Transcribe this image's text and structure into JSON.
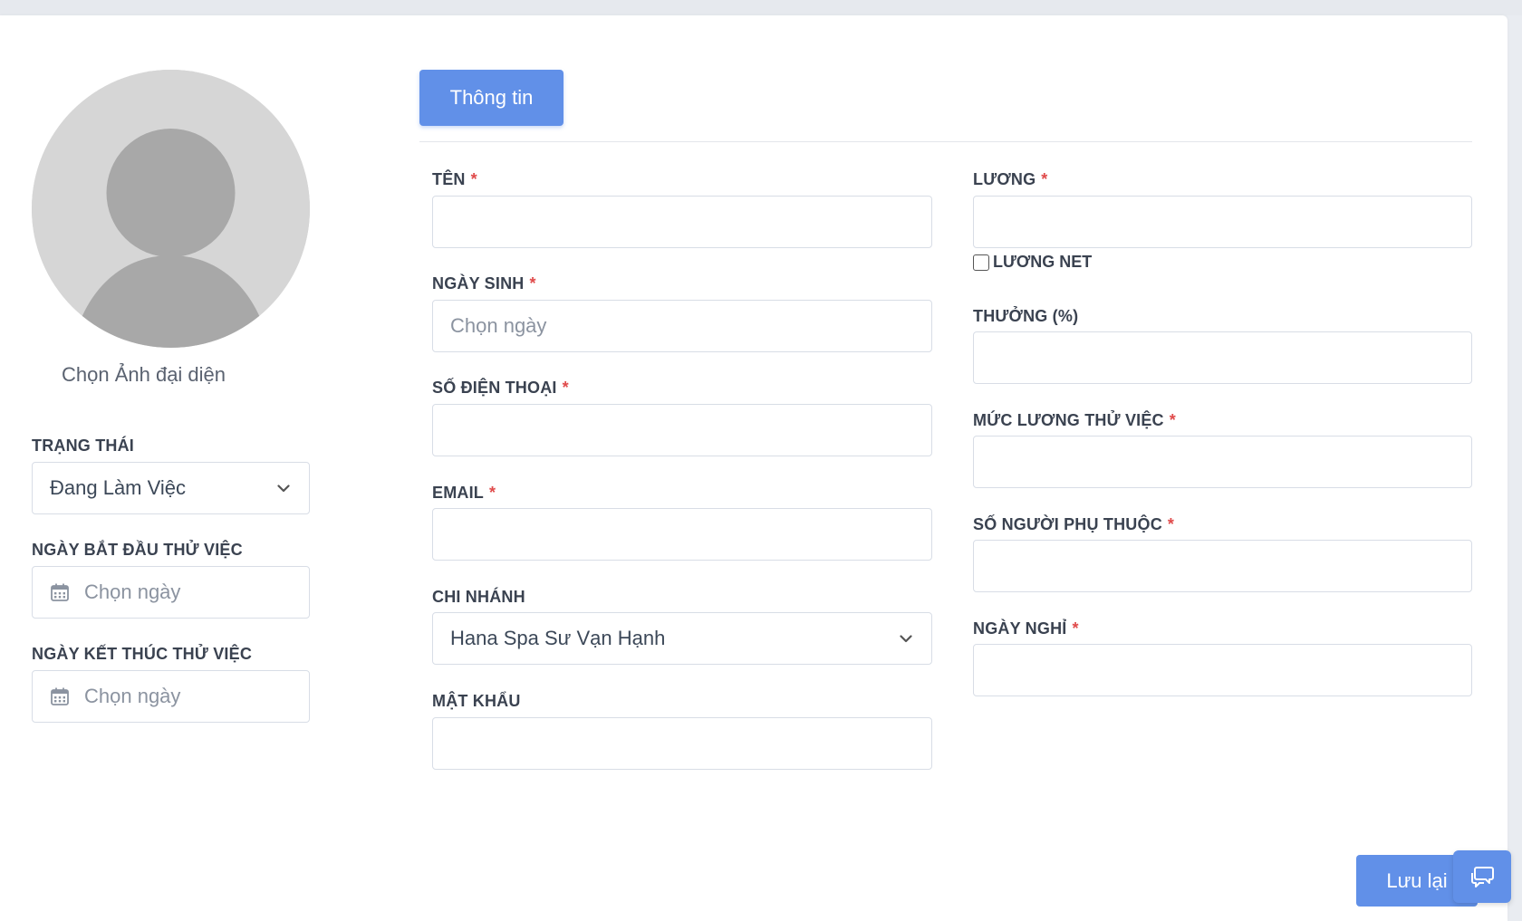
{
  "avatar": {
    "caption": "Chọn Ảnh đại diện"
  },
  "left": {
    "status": {
      "label": "TRẠNG THÁI",
      "value": "Đang Làm Việc"
    },
    "trial_start": {
      "label": "NGÀY BẮT ĐẦU THỬ VIỆC",
      "placeholder": "Chọn ngày"
    },
    "trial_end": {
      "label": "NGÀY KẾT THÚC THỬ VIỆC",
      "placeholder": "Chọn ngày"
    }
  },
  "tabs": [
    {
      "label": "Thông tin"
    }
  ],
  "form": {
    "name": {
      "label": "TÊN",
      "required": "*",
      "value": ""
    },
    "birthday": {
      "label": "NGÀY SINH",
      "required": "*",
      "placeholder": "Chọn ngày"
    },
    "phone": {
      "label": "SỐ ĐIỆN THOẠI",
      "required": "*",
      "value": ""
    },
    "email": {
      "label": "EMAIL",
      "required": "*",
      "value": ""
    },
    "branch": {
      "label": "CHI NHÁNH",
      "value": "Hana Spa Sư Vạn Hạnh"
    },
    "password": {
      "label": "MẬT KHẨU",
      "value": ""
    },
    "salary": {
      "label": "LƯƠNG",
      "required": "*",
      "value": ""
    },
    "net_salary": {
      "label": "LƯƠNG NET",
      "checked": false
    },
    "bonus": {
      "label": "THƯỞNG (%)",
      "value": ""
    },
    "trial_salary": {
      "label": "MỨC LƯƠNG THỬ VIỆC",
      "required": "*",
      "value": ""
    },
    "dependents": {
      "label": "SỐ NGƯỜI PHỤ THUỘC",
      "required": "*",
      "value": ""
    },
    "days_off": {
      "label": "NGÀY NGHỈ",
      "required": "*",
      "value": ""
    }
  },
  "actions": {
    "save_label": "Lưu lại"
  },
  "icons": {
    "avatar": "user-placeholder-icon",
    "chevron": "chevron-down-icon",
    "calendar": "calendar-icon",
    "chat": "chat-icon"
  },
  "colors": {
    "accent": "#6190e8",
    "required": "#e04b4b"
  }
}
